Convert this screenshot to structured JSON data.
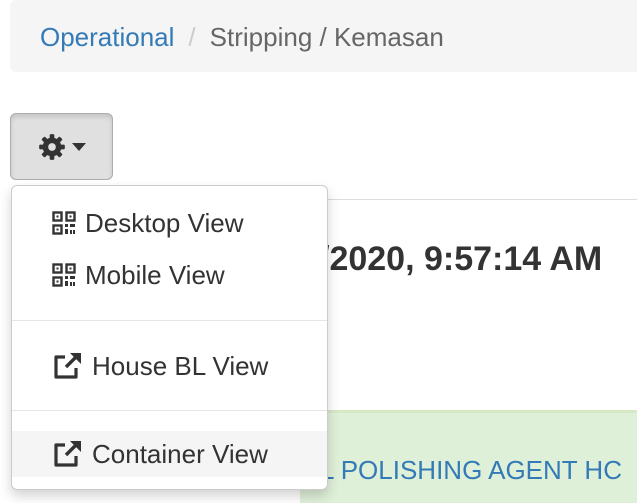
{
  "breadcrumb": {
    "items": [
      "Operational",
      "Stripping / Kemasan"
    ],
    "separator": "/"
  },
  "toolbar": {
    "settings_icon": "gear-icon",
    "caret_icon": "caret-down-icon"
  },
  "dropdown": {
    "items": [
      {
        "label": "Desktop View",
        "icon": "qrcode-icon"
      },
      {
        "label": "Mobile View",
        "icon": "qrcode-icon"
      },
      {
        "label": "House BL View",
        "icon": "external-link-icon"
      },
      {
        "label": "Container View",
        "icon": "external-link-icon"
      }
    ]
  },
  "main": {
    "timestamp": "/2020, 9:57:14 AM",
    "alert_text": "L POLISHING AGENT HC"
  },
  "colors": {
    "link": "#337ab7",
    "breadcrumb_bg": "#f5f5f5",
    "success_bg": "#dff0d8",
    "button_active_bg": "#e0e0e0"
  }
}
